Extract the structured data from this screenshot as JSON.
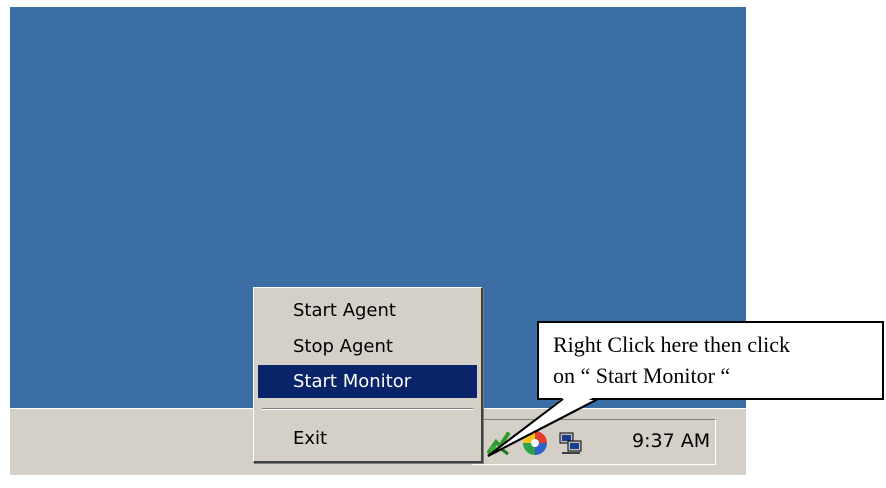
{
  "taskbar": {
    "clock": "9:37 AM",
    "tray_icons": [
      "agent-tray-icon",
      "app-tray-icon",
      "network-tray-icon"
    ]
  },
  "context_menu": {
    "items": [
      {
        "label": "Start Agent",
        "selected": false
      },
      {
        "label": "Stop Agent",
        "selected": false
      },
      {
        "label": "Start Monitor",
        "selected": true
      },
      {
        "label": "Exit",
        "selected": false
      }
    ]
  },
  "callout": {
    "line1": "Right Click here then click",
    "line2": "on “ Start Monitor “"
  },
  "colors": {
    "desktop": "#3a6ea5",
    "taskbar": "#d4d0c8",
    "menu_highlight": "#0a246a"
  }
}
